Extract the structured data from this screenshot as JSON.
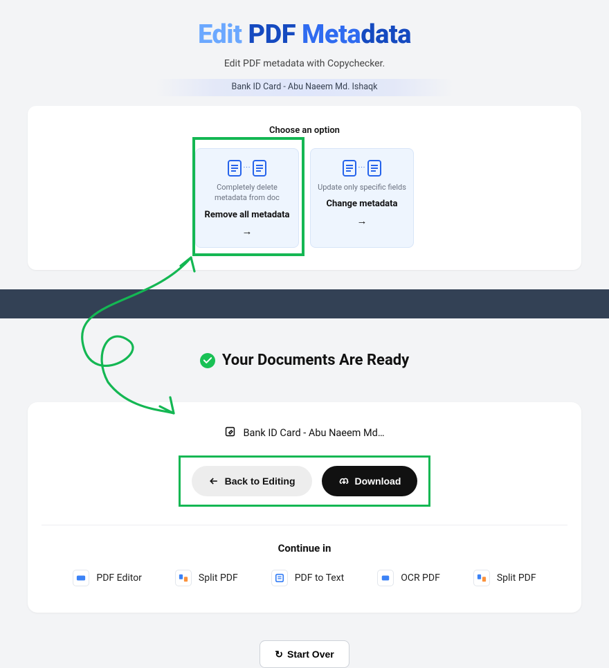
{
  "header": {
    "title_edit": "Edit",
    "title_pdf": "PDF",
    "title_meta": "Meta",
    "title_data": "data",
    "subtitle": "Edit PDF metadata with Copychecker.",
    "filename": "Bank ID Card - Abu Naeem Md. Ishaqk"
  },
  "options": {
    "heading": "Choose an option",
    "remove": {
      "desc": "Completely delete metadata from doc",
      "title": "Remove all metadata"
    },
    "change": {
      "desc": "Update only specific fields",
      "title": "Change metadata"
    }
  },
  "ready": {
    "title": "Your Documents Are Ready",
    "doc_name": "Bank ID Card - Abu Naeem Md…",
    "back_label": "Back to Editing",
    "download_label": "Download"
  },
  "continue": {
    "label": "Continue in",
    "tools": [
      {
        "label": "PDF Editor"
      },
      {
        "label": "Split PDF"
      },
      {
        "label": "PDF to Text"
      },
      {
        "label": "OCR PDF"
      },
      {
        "label": "Split PDF"
      }
    ]
  },
  "start_over": "Start Over"
}
